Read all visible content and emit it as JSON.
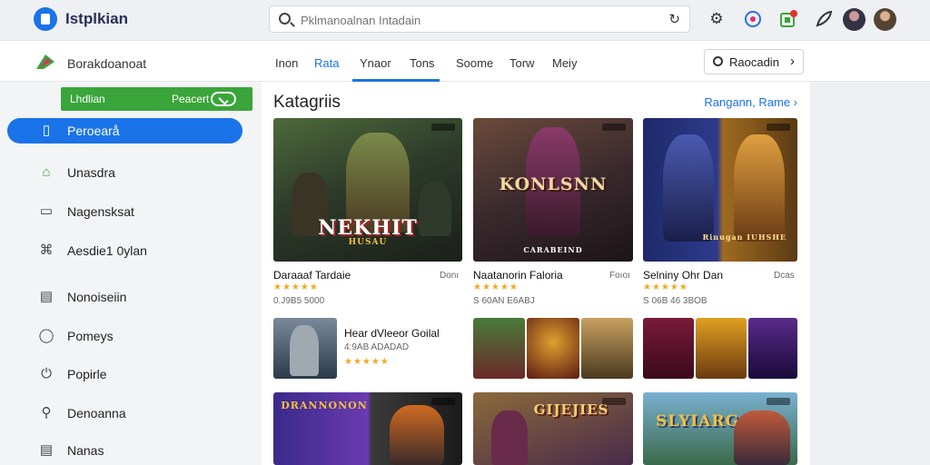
{
  "app": {
    "title_main": "Istplkian",
    "title_accent": ""
  },
  "search": {
    "placeholder": "Pklmanoalnan Intadain",
    "value": ""
  },
  "topbar": {
    "icons": [
      "logo-icon",
      "search-icon",
      "refresh-icon",
      "settings-icon",
      "globe-icon",
      "store-icon",
      "feather-icon"
    ]
  },
  "nav": {
    "brand": "Borakdoanoat",
    "tabs": [
      "Inon",
      "Rata",
      "Ynaor",
      "Tons",
      "Soome",
      "Torw",
      "Meiy"
    ],
    "active_tab": 2,
    "action_button": "Raocadin"
  },
  "sidebar": {
    "promo_left": "Lhdlian",
    "promo_right": "Peacert",
    "items": [
      {
        "label": "Peroearå",
        "icon": "book-icon",
        "active": true
      },
      {
        "label": "Unasdra",
        "icon": "home-icon",
        "active": false
      },
      {
        "label": "Nagensksat",
        "icon": "window-icon",
        "active": false
      },
      {
        "label": "Aesdie1 0ylan",
        "icon": "game-icon",
        "active": false
      },
      {
        "label": "Nonoiseiin",
        "icon": "list-icon",
        "active": false
      },
      {
        "label": "Pomeys",
        "icon": "chat-icon",
        "active": false
      },
      {
        "label": "Popirle",
        "icon": "power-icon",
        "active": false
      },
      {
        "label": "Denoanna",
        "icon": "search-icon",
        "active": false
      },
      {
        "label": "Nanas",
        "icon": "menu-icon",
        "active": false
      }
    ]
  },
  "main": {
    "section_title": "Katagriis",
    "section_link": "Rangann, Rame ›",
    "featured": [
      {
        "name": "Daraaaf Tardaie",
        "price": "Donı",
        "stars": "★★★★★",
        "meta": "0.J9B5 5000",
        "banner": "NEKHIT",
        "sub": "HUSAU"
      },
      {
        "name": "Naatanorin Faloria",
        "price": "Foıoı",
        "stars": "★★★★★",
        "meta": "S 60AN E6ABJ",
        "banner": "KONLSNN",
        "sub": "CARABEIND"
      },
      {
        "name": "Selniny Ohr Dan",
        "price": "Dcas",
        "stars": "★★★★★",
        "meta": "S 06B 46 3BOB",
        "banner": "",
        "sub": "Rinugan IUHSHE"
      }
    ],
    "compact": {
      "name": "Hear dVleeor Goilal",
      "meta": "4:9AB ADADAD",
      "stars": "★★★★★"
    },
    "bottom_banners": [
      "DRANNONON",
      "GIJEJIES",
      "SLYIARG"
    ]
  }
}
